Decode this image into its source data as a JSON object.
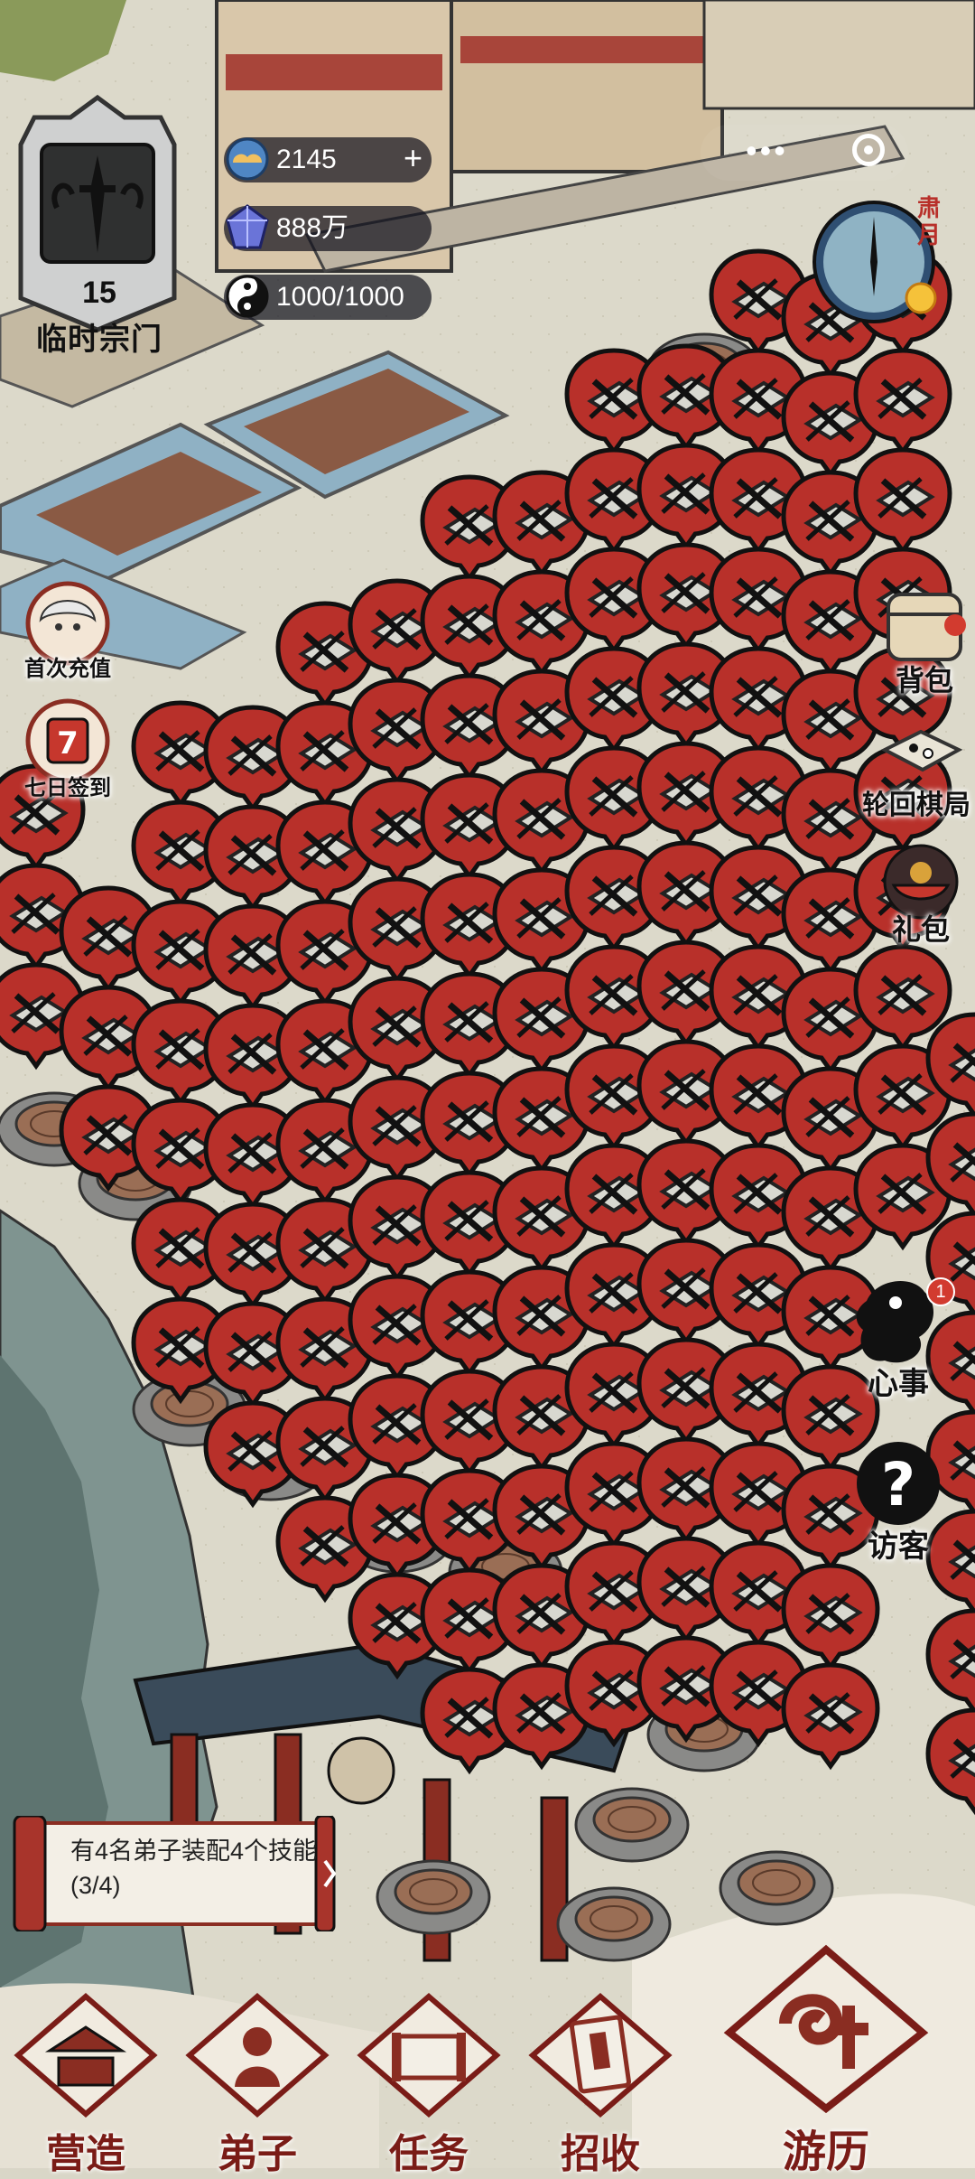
{
  "sect": {
    "level": "15",
    "name": "临时宗门"
  },
  "resources": {
    "spirit_stones": "2145",
    "spirit_stones_add": "+",
    "gems": "888万",
    "yin_yang": "1000/1000"
  },
  "season": {
    "label": "肃月"
  },
  "left_events": [
    {
      "label": "首次充值"
    },
    {
      "label": "七日签到"
    }
  ],
  "right_menu": [
    {
      "label": "背包"
    },
    {
      "label": "轮回棋局"
    },
    {
      "label": "礼包"
    }
  ],
  "right_actions": [
    {
      "label": "心事",
      "badge": "1"
    },
    {
      "label": "访客"
    }
  ],
  "quest": {
    "text": "有4名弟子装配4个技能(3/4)"
  },
  "bottom_nav": [
    {
      "label": "营造"
    },
    {
      "label": "弟子"
    },
    {
      "label": "任务"
    },
    {
      "label": "招收"
    },
    {
      "label": "游历"
    }
  ],
  "colors": {
    "marker_red": "#b8302a",
    "ink": "#111111",
    "nav_red": "#7a1c17",
    "paper": "#ece8db",
    "water": "#8fb1c4"
  }
}
